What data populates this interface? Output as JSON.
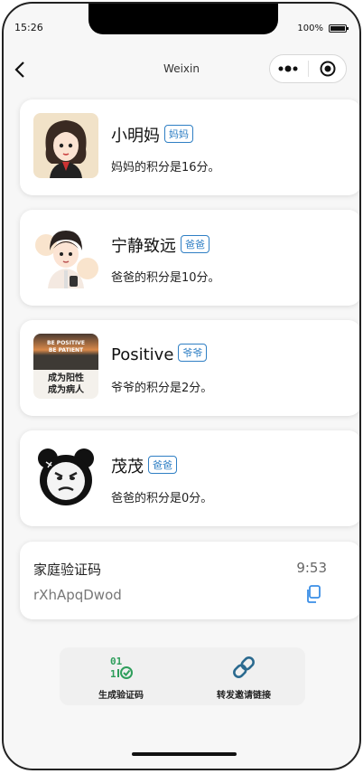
{
  "status_bar": {
    "time": "15:26",
    "battery": "100%"
  },
  "nav": {
    "title": "Weixin"
  },
  "members": [
    {
      "name": "小明妈",
      "role": "妈妈",
      "points_text": "妈妈的积分是16分。"
    },
    {
      "name": "宁静致远",
      "role": "爸爸",
      "points_text": "爸爸的积分是10分。"
    },
    {
      "name": "Positive",
      "role": "爷爷",
      "points_text": "爷爷的积分是2分。",
      "avatar_text": [
        "BE POSITIVE",
        "BE PATIENT",
        "成为阳性",
        "成为病人"
      ]
    },
    {
      "name": "茂茂",
      "role": "爸爸",
      "points_text": "爸爸的积分是0分。"
    }
  ],
  "verification": {
    "title": "家庭验证码",
    "code": "rXhApqDwod",
    "timer": "9:53"
  },
  "actions": {
    "generate_code": {
      "label": "生成验证码",
      "icon_text": "01"
    },
    "share_invite": {
      "label": "转发邀请链接"
    }
  },
  "colors": {
    "accent": "#2f7fc4",
    "green": "#2e9e5b"
  }
}
